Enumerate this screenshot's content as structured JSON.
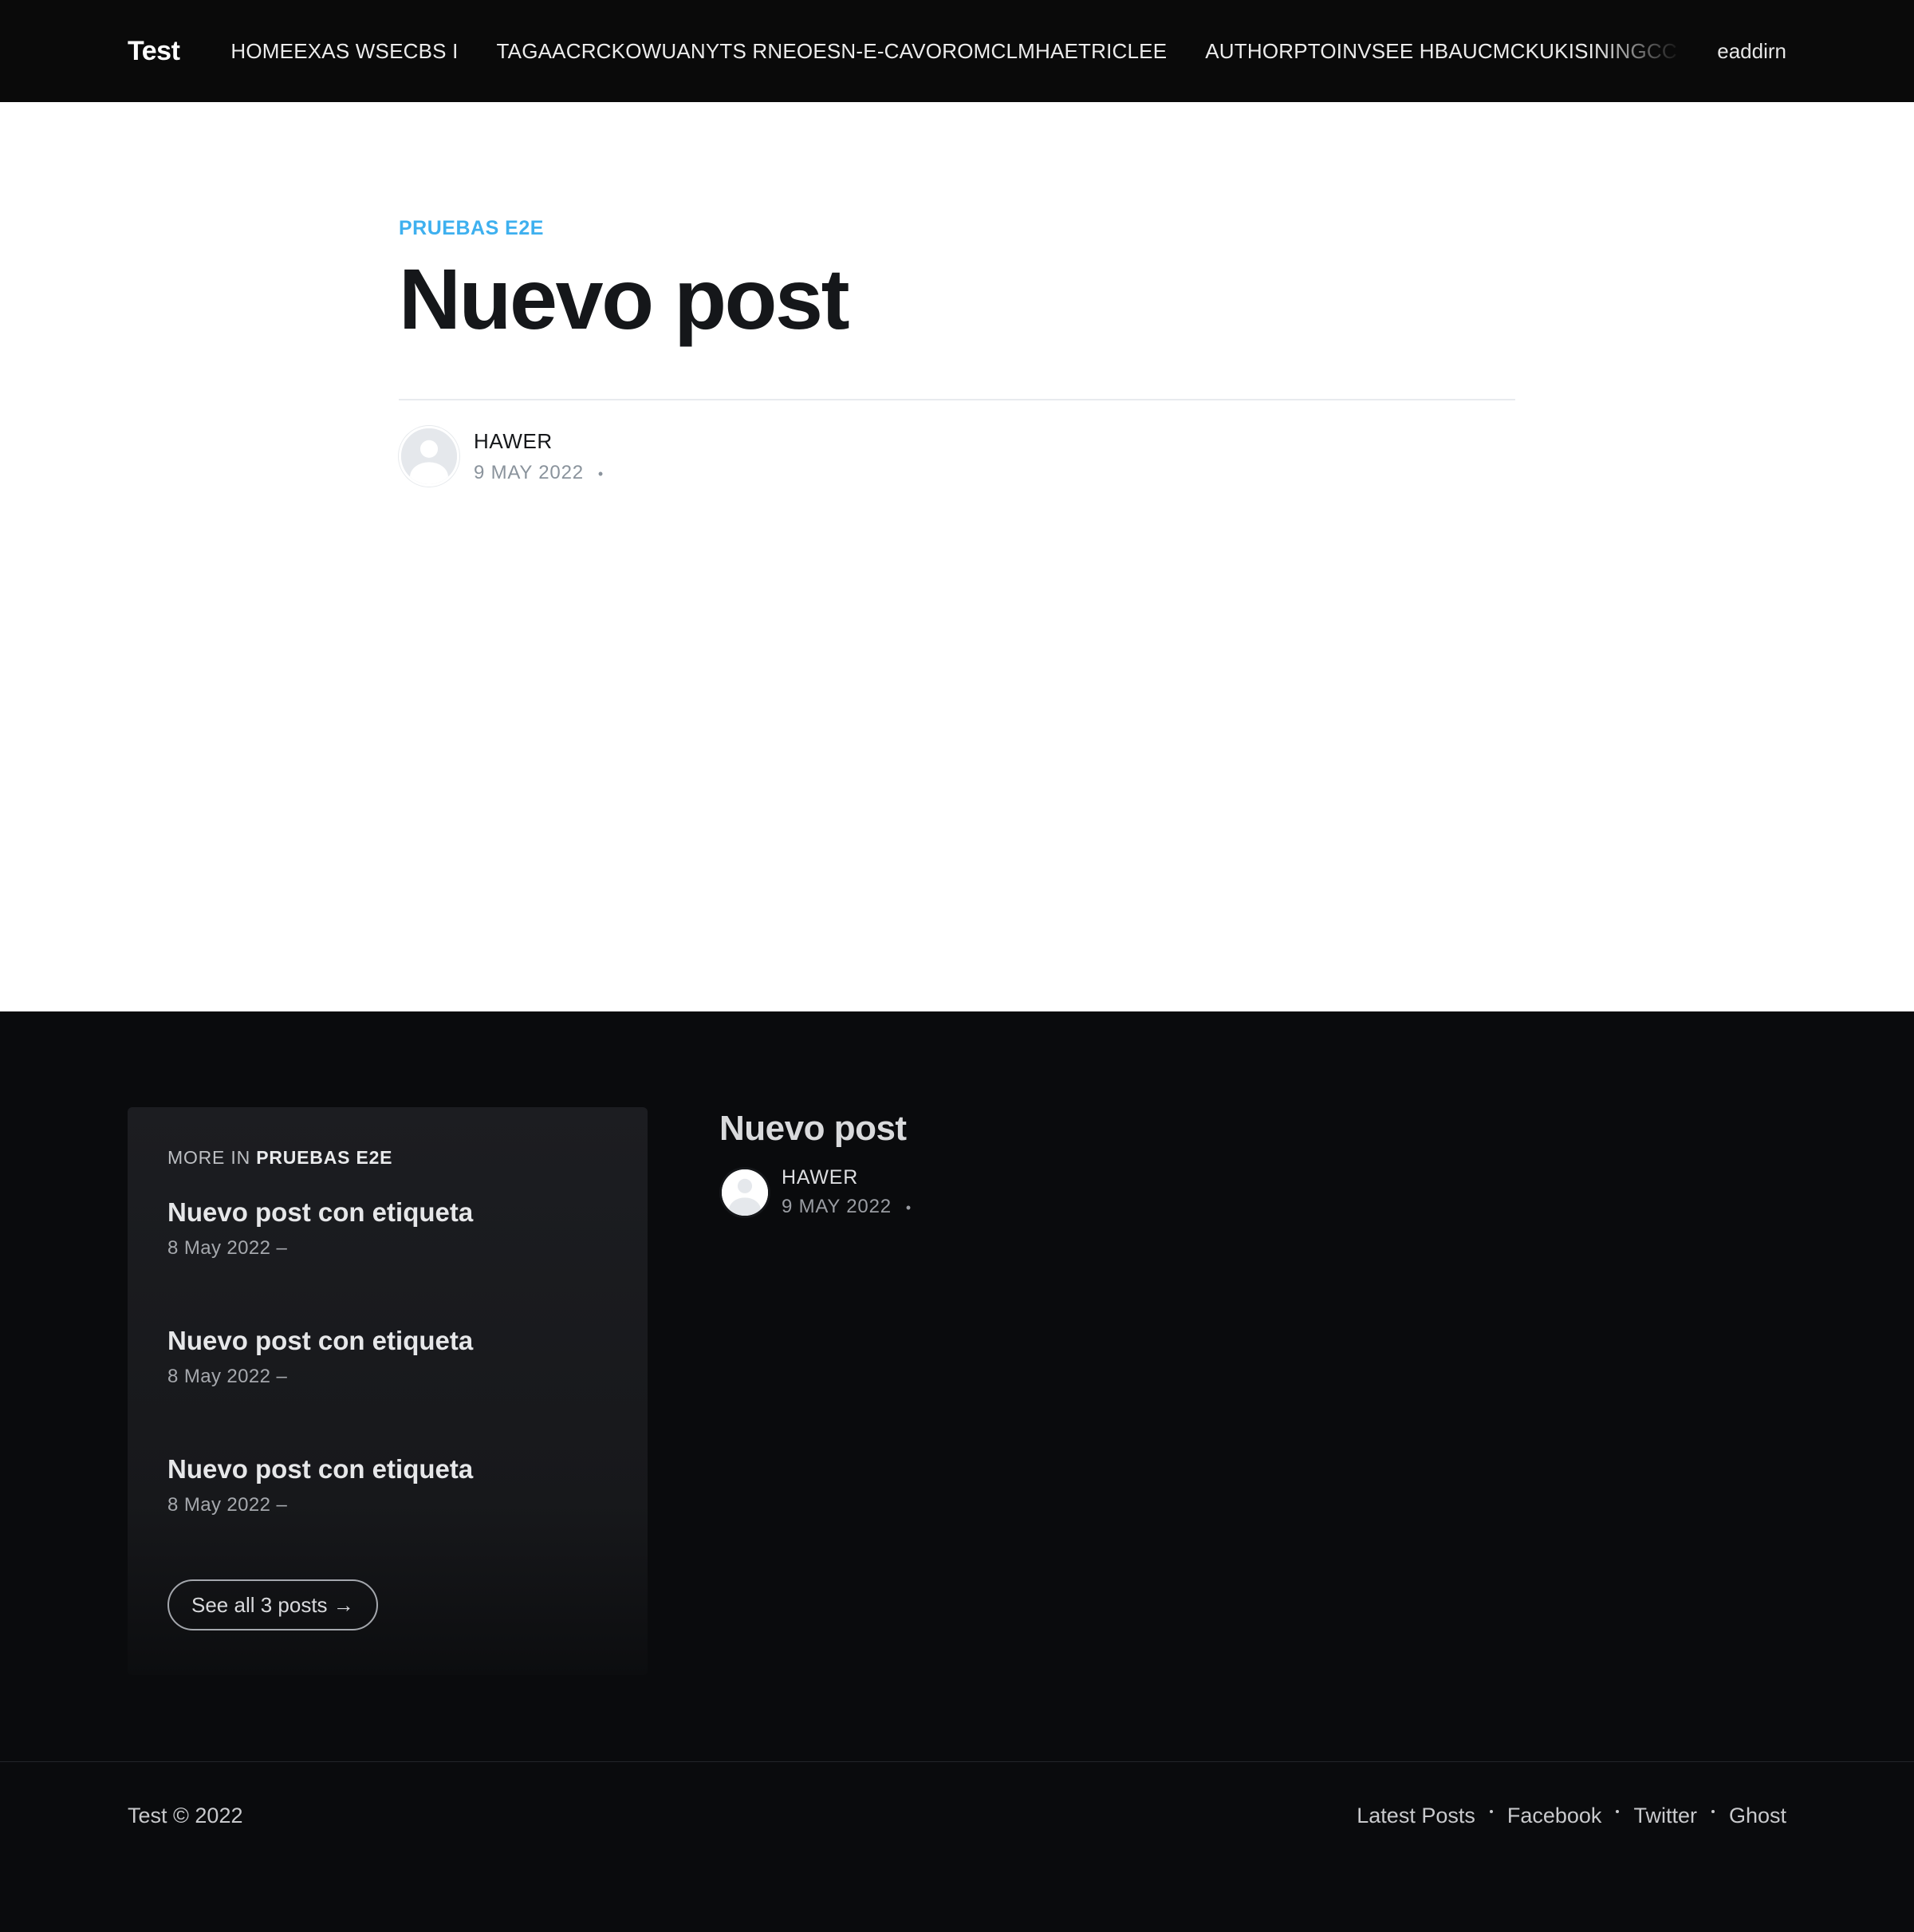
{
  "header": {
    "logo": "Test",
    "nav": [
      "HOMEEXAS WSECBS I",
      "TAGAACRCKOWUANYTS RNEOESN-E-CAVOROMCLMHAETRICLEE",
      "AUTHORPTOINVSEE HBAUCMCKUKISININGCC"
    ],
    "signin": "eaddirn"
  },
  "article": {
    "tag": "PRUEBAS E2E",
    "title": "Nuevo post",
    "author": "HAWER",
    "date": "9 MAY 2022",
    "separator": "•"
  },
  "more_in": {
    "label": "MORE IN",
    "tag": "PRUEBAS E2E",
    "items": [
      {
        "title": "Nuevo post con etiqueta",
        "date": "8 May 2022 –"
      },
      {
        "title": "Nuevo post con etiqueta",
        "date": "8 May 2022 –"
      },
      {
        "title": "Nuevo post con etiqueta",
        "date": "8 May 2022 –"
      }
    ],
    "see_all": "See all 3 posts →"
  },
  "related_post": {
    "title": "Nuevo post",
    "author": "HAWER",
    "date": "9 MAY 2022",
    "separator": "•"
  },
  "footer": {
    "copyright": "Test © 2022",
    "links": [
      "Latest Posts",
      "Facebook",
      "Twitter",
      "Ghost"
    ]
  },
  "icons": {
    "avatar": "user-silhouette-icon",
    "arrow": "arrow-right-icon"
  },
  "colors": {
    "accent": "#3eb0ef",
    "header_bg": "#0a0a0a",
    "footer_bg": "#0a0b0d",
    "card_bg": "#1c1d21"
  }
}
